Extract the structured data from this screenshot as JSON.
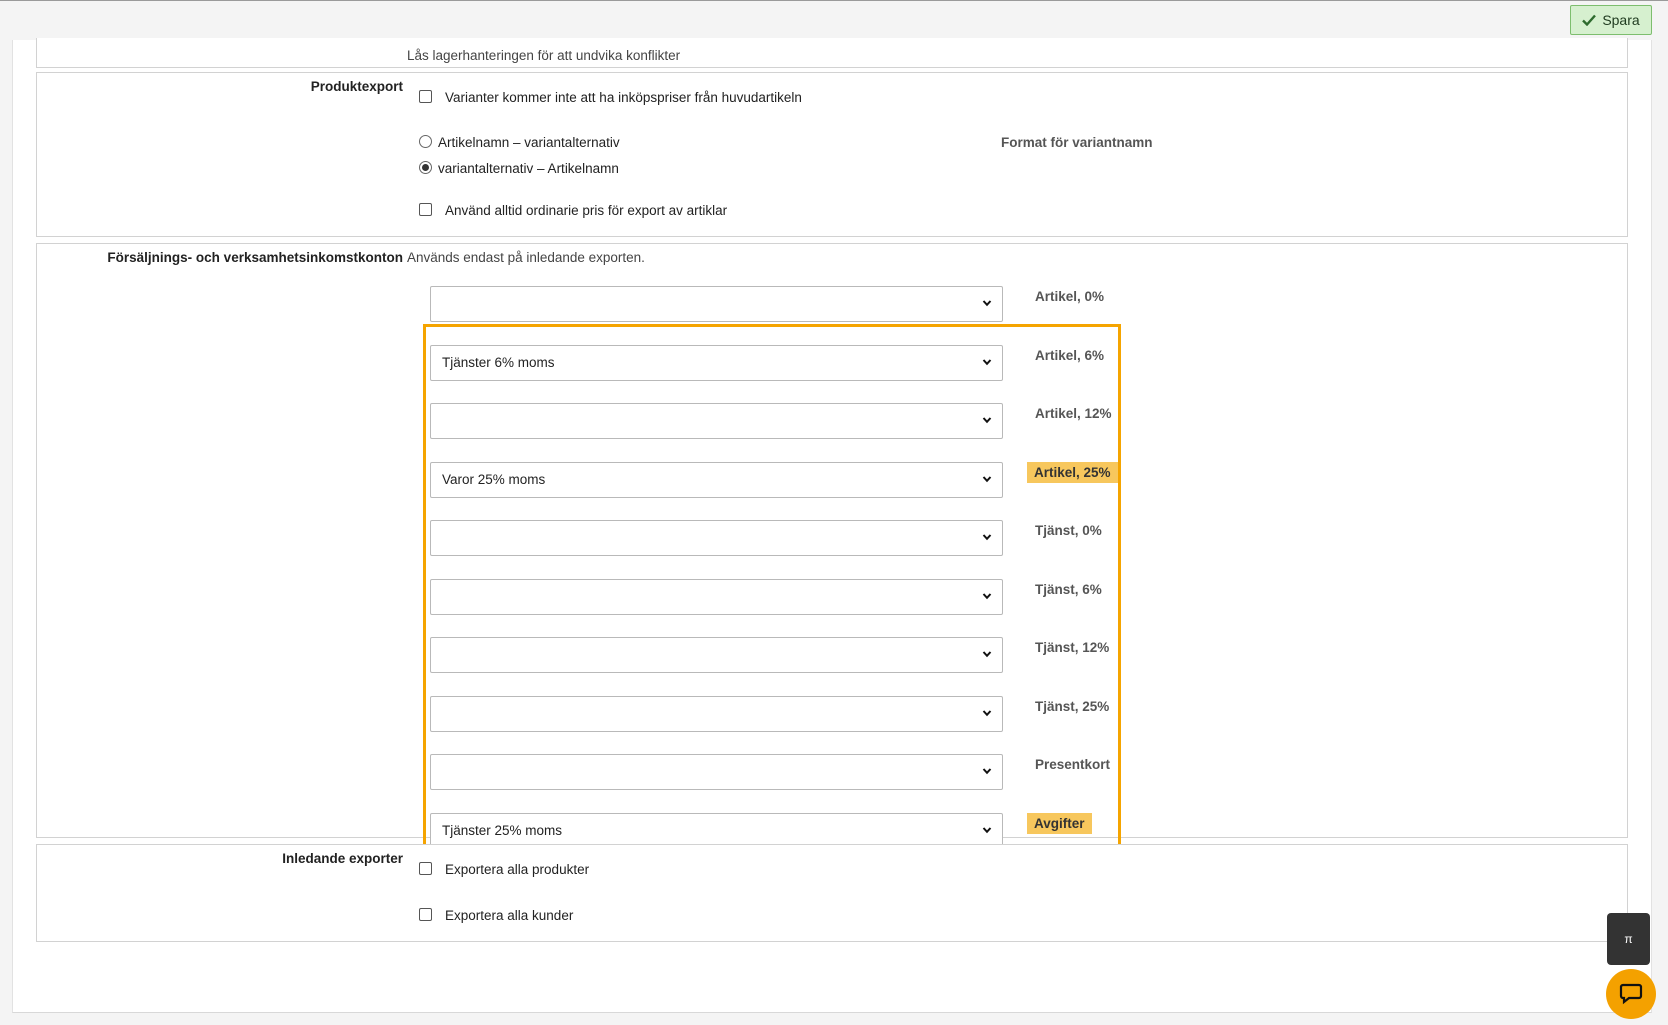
{
  "toolbar": {
    "save_label": "Spara"
  },
  "lock_section": {
    "hint": "Lås lagerhanteringen för att undvika konflikter"
  },
  "product_export": {
    "label": "Produktexport",
    "no_purchase_price_label": "Varianter kommer inte att ha inköpspriser från huvudartikeln",
    "name_format_options": [
      {
        "label": "Artikelnamn – variantalternativ",
        "checked": false
      },
      {
        "label": "variantalternativ – Artikelnamn",
        "checked": true
      }
    ],
    "name_format_label": "Format för variantnamn",
    "ordinary_price_label": "Använd alltid ordinarie pris för export av artiklar"
  },
  "income_accounts": {
    "label": "Försäljnings- och verksamhetsinkomstkonton",
    "hint": "Används endast på inledande exporten.",
    "rows": [
      {
        "value": "",
        "label": "Artikel, 0%",
        "highlighted": false
      },
      {
        "value": "Tjänster 6% moms",
        "label": "Artikel, 6%",
        "highlighted": false
      },
      {
        "value": "",
        "label": "Artikel, 12%",
        "highlighted": false
      },
      {
        "value": "Varor 25% moms",
        "label": "Artikel, 25%",
        "highlighted": true
      },
      {
        "value": "",
        "label": "Tjänst, 0%",
        "highlighted": false
      },
      {
        "value": "",
        "label": "Tjänst, 6%",
        "highlighted": false
      },
      {
        "value": "",
        "label": "Tjänst, 12%",
        "highlighted": false
      },
      {
        "value": "",
        "label": "Tjänst, 25%",
        "highlighted": false
      },
      {
        "value": "",
        "label": "Presentkort",
        "highlighted": false
      },
      {
        "value": "Tjänster 25% moms",
        "label": "Avgifter",
        "highlighted": true
      }
    ]
  },
  "initial_exports": {
    "label": "Inledande exporter",
    "export_all_products_label": "Exportera alla produkter",
    "export_all_customers_label": "Exportera alla kunder"
  },
  "floating": {
    "pi_button_label": "π"
  },
  "colors": {
    "highlight": "#f7c75d",
    "frame": "#f5a400",
    "save_bg": "#d6f0cf",
    "chat": "#f4a100"
  }
}
